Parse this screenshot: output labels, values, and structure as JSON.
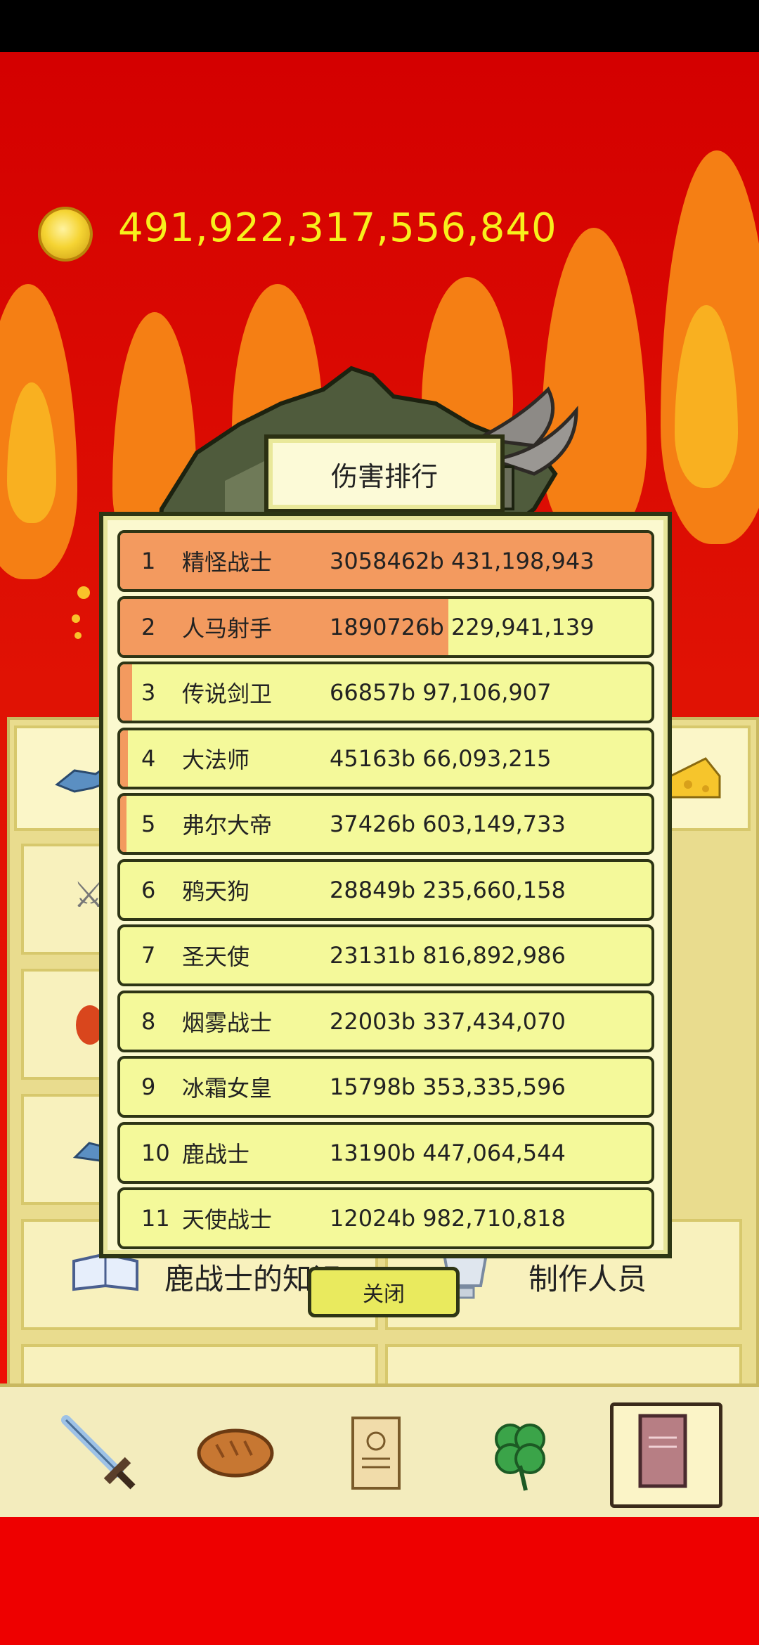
{
  "header": {
    "coins": "491,922,317,556,840",
    "coin_icon": "gold-coin-icon"
  },
  "modal": {
    "title": "伤害排行",
    "close_label": "关闭",
    "rows": [
      {
        "rank": "1",
        "name": "精怪战士",
        "value": "3058462b 431,198,943",
        "share": 1.0
      },
      {
        "rank": "2",
        "name": "人马射手",
        "value": "1890726b 229,941,139",
        "share": 0.618
      },
      {
        "rank": "3",
        "name": "传说剑卫",
        "value": "66857b 97,106,907",
        "share": 0.022
      },
      {
        "rank": "4",
        "name": "大法师",
        "value": "45163b 66,093,215",
        "share": 0.015
      },
      {
        "rank": "5",
        "name": "弗尔大帝",
        "value": "37426b 603,149,733",
        "share": 0.012
      },
      {
        "rank": "6",
        "name": "鸦天狗",
        "value": "28849b 235,660,158",
        "share": 0.0
      },
      {
        "rank": "7",
        "name": "圣天使",
        "value": "23131b 816,892,986",
        "share": 0.0
      },
      {
        "rank": "8",
        "name": "烟雾战士",
        "value": "22003b 337,434,070",
        "share": 0.0
      },
      {
        "rank": "9",
        "name": "冰霜女皇",
        "value": "15798b 353,335,596",
        "share": 0.0
      },
      {
        "rank": "10",
        "name": "鹿战士",
        "value": "13190b 447,064,544",
        "share": 0.0
      },
      {
        "rank": "11",
        "name": "天使战士",
        "value": "12024b 982,710,818",
        "share": 0.0
      }
    ]
  },
  "menu": {
    "knowledge_label": "鹿战士的知识",
    "credits_label": "制作人员"
  },
  "nav": {
    "items": [
      "sword-icon",
      "bread-icon",
      "scroll-icon",
      "clover-icon",
      "book-icon"
    ],
    "active_index": 4
  },
  "colors": {
    "bar": "#f39a5f",
    "row": "#f4f99a",
    "coin_text": "#f7f01c"
  }
}
